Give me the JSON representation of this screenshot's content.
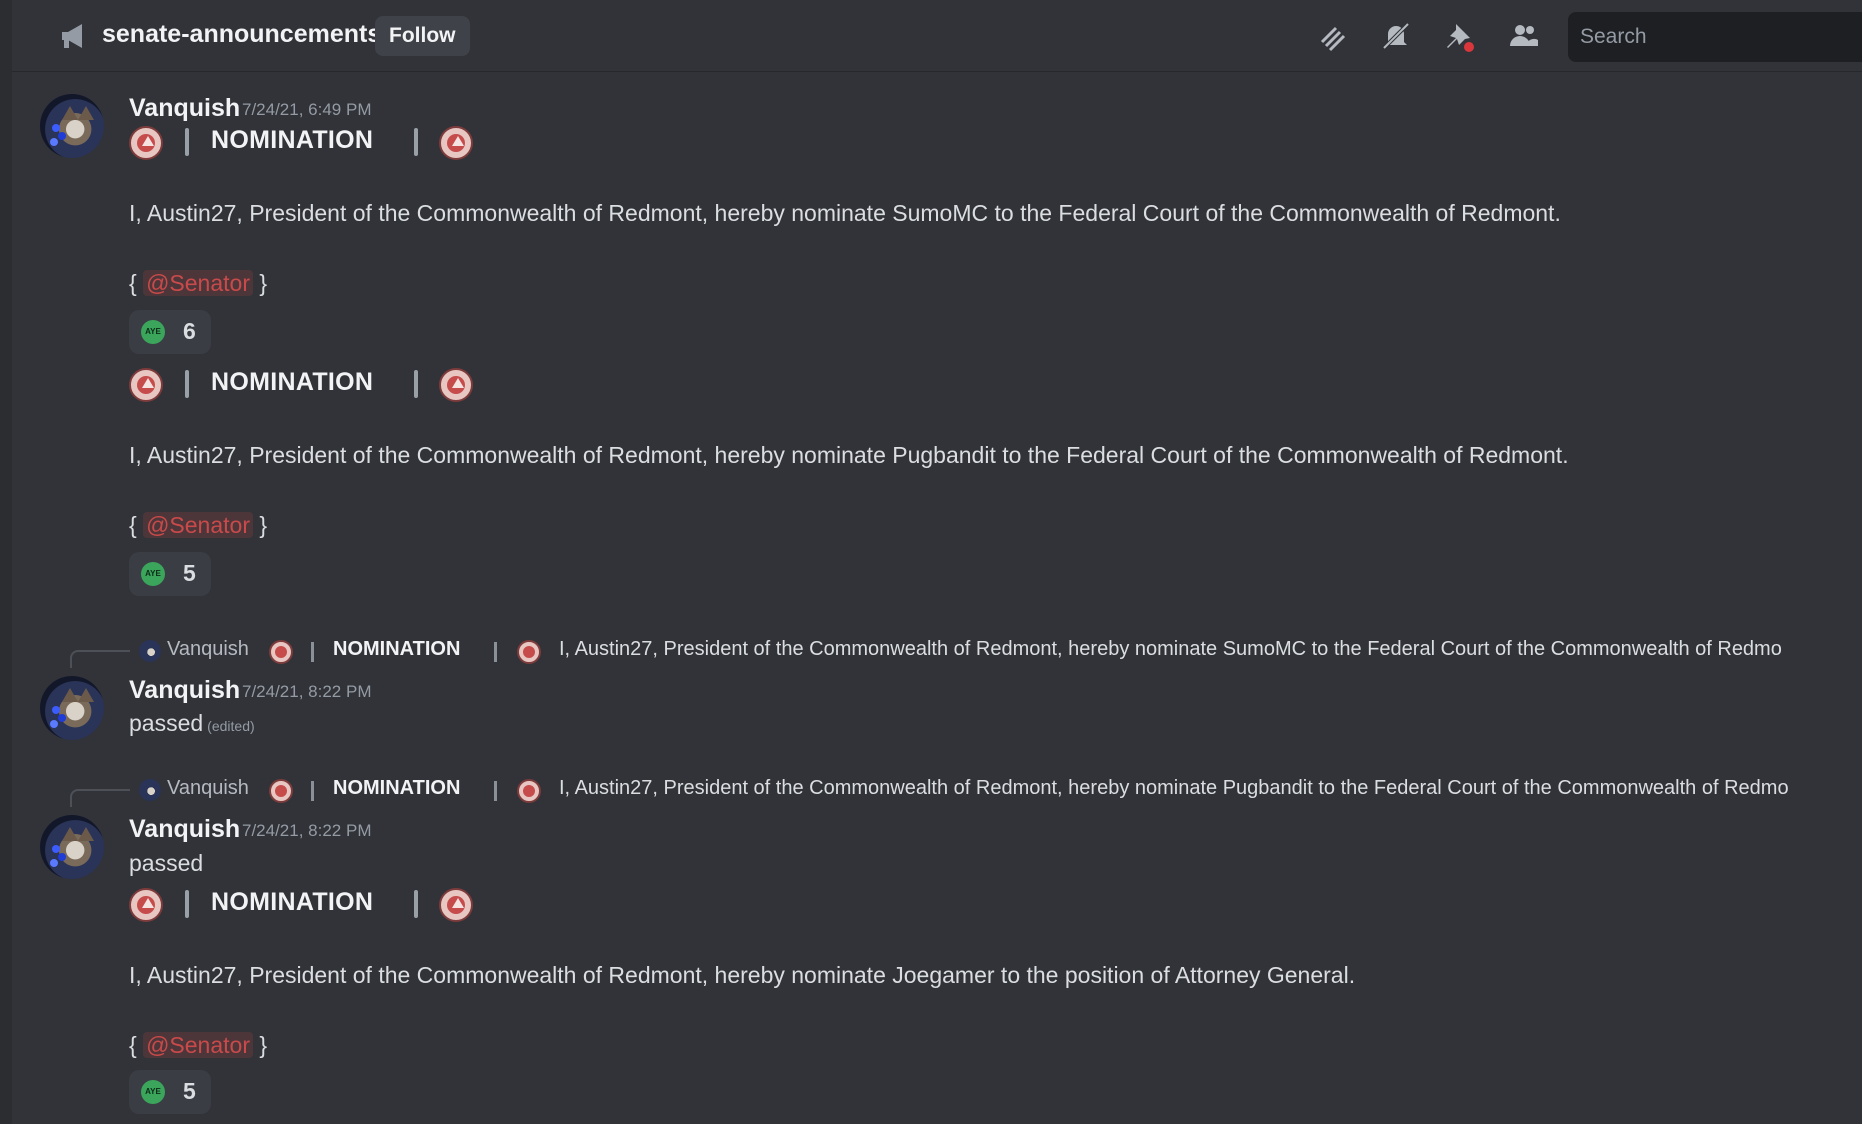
{
  "header": {
    "channel_name": "senate-announcements",
    "follow_label": "Follow",
    "search_placeholder": "Search",
    "icons": [
      "threads-icon",
      "mute-bell-icon",
      "pin-icon",
      "members-icon"
    ]
  },
  "messages": [
    {
      "username": "Vanquish",
      "timestamp": "7/24/21, 6:49 PM",
      "nominations": [
        {
          "title": "NOMINATION",
          "body": "I, Austin27, President of the Commonwealth of Redmont, hereby nominate SumoMC to the Federal Court of the Commonwealth of Redmont.",
          "mention_open": "{",
          "mention": "@Senator",
          "mention_close": "}",
          "reaction_label": "AYE",
          "reaction_count": "6"
        },
        {
          "title": "NOMINATION",
          "body": "I, Austin27, President of the Commonwealth of Redmont, hereby nominate Pugbandit to the Federal Court of the Commonwealth of Redmont.",
          "mention_open": "{",
          "mention": "@Senator",
          "mention_close": "}",
          "reaction_label": "AYE",
          "reaction_count": "5"
        }
      ]
    },
    {
      "reply_to": {
        "username": "Vanquish",
        "title": "NOMINATION",
        "snippet": "I, Austin27, President of the Commonwealth of Redmont, hereby nominate SumoMC to the Federal Court of the Commonwealth of Redmo"
      },
      "username": "Vanquish",
      "timestamp": "7/24/21, 8:22 PM",
      "body": "passed",
      "edited": "(edited)"
    },
    {
      "reply_to": {
        "username": "Vanquish",
        "title": "NOMINATION",
        "snippet": "I, Austin27, President of the Commonwealth of Redmont, hereby nominate Pugbandit to the Federal Court of the Commonwealth of Redmo"
      },
      "username": "Vanquish",
      "timestamp": "7/24/21, 8:22 PM",
      "body": "passed",
      "nomination": {
        "title": "NOMINATION",
        "body": "I, Austin27, President of the Commonwealth of Redmont, hereby nominate Joegamer to the position of Attorney General.",
        "mention_open": "{",
        "mention": "@Senator",
        "mention_close": "}",
        "reaction_label": "AYE",
        "reaction_count": "5"
      }
    }
  ],
  "colors": {
    "background": "#313338",
    "mention": "#c94a4a",
    "aye_green": "#3ba55c"
  }
}
